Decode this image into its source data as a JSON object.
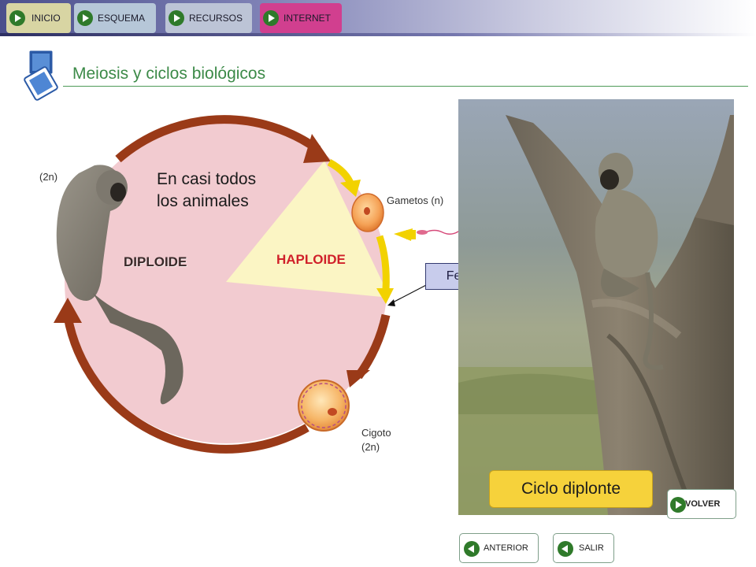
{
  "nav": {
    "inicio": "INICIO",
    "esquema": "ESQUEMA",
    "recursos": "RECURSOS",
    "internet": "INTERNET"
  },
  "page_title": "Meiosis y ciclos biológicos",
  "diagram": {
    "adult_ploidy": "(2n)",
    "scope_line1": "En casi todos",
    "scope_line2": "los animales",
    "gametes_label": "Gametos (n)",
    "diploid_label": "DIPLOIDE",
    "haploid_label": "HAPLOIDE",
    "fertilization_label": "Fecundación",
    "zygote_line1": "Cigoto",
    "zygote_line2": "(2n)"
  },
  "photo_caption": "Ciclo diplonte",
  "buttons": {
    "volver": "VOLVER",
    "anterior": "ANTERIOR",
    "salir": "SALIR"
  },
  "colors": {
    "title_green": "#3c8a48",
    "diploid_fill": "#f2cbd0",
    "haploid_fill": "#fbf5c4",
    "arrow_brown": "#9a3a18",
    "arrow_yellow": "#f2d200",
    "caption_yellow": "#f6d23b",
    "fertilization_box": "#c8ccec",
    "nav_internet": "#d13f8f"
  }
}
